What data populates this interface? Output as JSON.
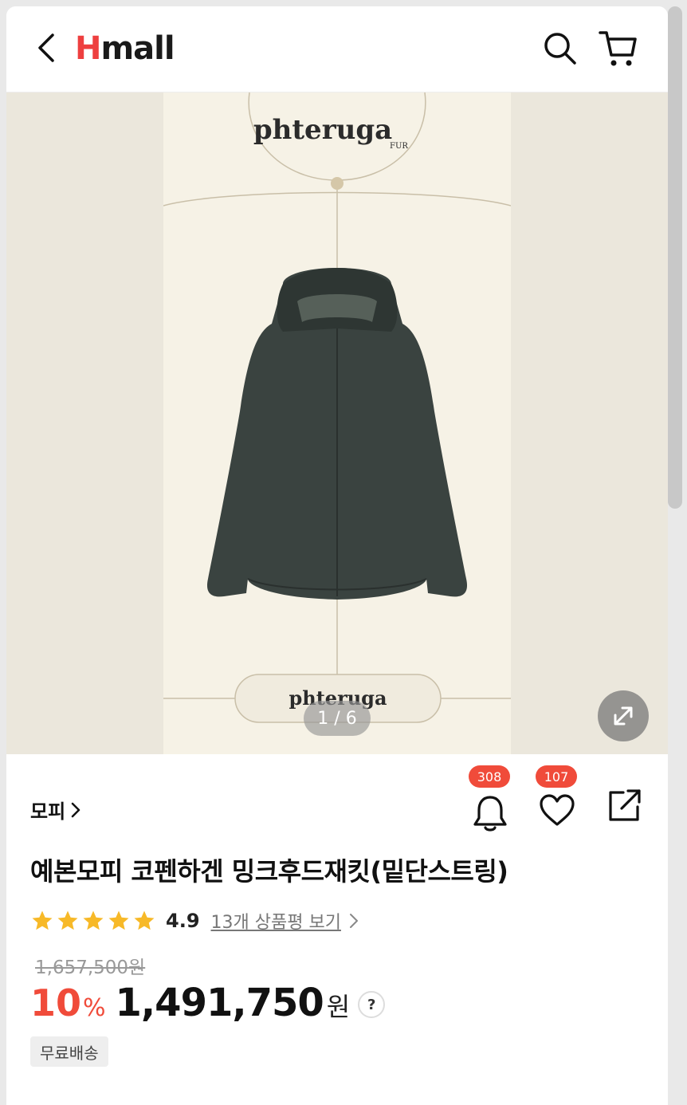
{
  "header": {
    "logo_h": "H",
    "logo_rest": "mall",
    "back_icon": "chevron-left-icon",
    "search_icon": "search-icon",
    "cart_icon": "cart-icon"
  },
  "gallery": {
    "brand_top": "phteruga",
    "brand_top_sub": "FUR",
    "brand_bottom": "phteruga",
    "counter": "1 / 6",
    "expand_icon": "expand-icon"
  },
  "product": {
    "category": "모피",
    "title": "예본모피 코펜하겐 밍크후드재킷(밑단스트링)",
    "alarm_count": "308",
    "like_count": "107",
    "rating": "4.9",
    "review_link": "13개 상품평 보기",
    "original_price": "1,657,500원",
    "discount": "10",
    "discount_unit": "%",
    "price": "1,491,750",
    "price_unit": "원",
    "help": "?",
    "shipping_tag": "무료배송"
  },
  "colors": {
    "accent": "#f04b3a",
    "logo_h": "#ee3f3f",
    "star": "#f7b928"
  }
}
